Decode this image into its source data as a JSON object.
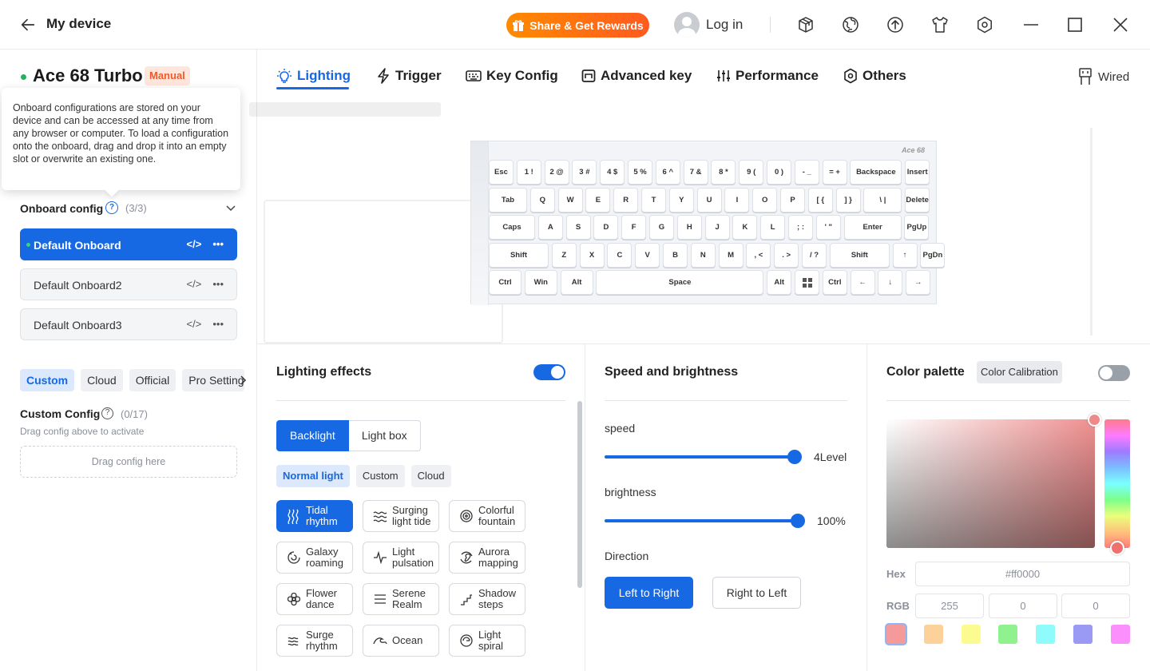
{
  "header": {
    "back_label": "My device",
    "rewards_label": "Share & Get Rewards",
    "login_label": "Log in"
  },
  "sidebar": {
    "device_name": "Ace 68 Turbo",
    "mode_badge": "Manual",
    "tooltip_text": "Onboard configurations are stored on your device and can be accessed at any time from any browser or computer. To load a configuration onto the onboard, drag and drop it into an empty slot or overwrite an existing one.",
    "onboard_label": "Onboard config",
    "onboard_count": "(3/3)",
    "slots": [
      "Default Onboard",
      "Default Onboard2",
      "Default Onboard3"
    ],
    "config_tabs": [
      "Custom",
      "Cloud",
      "Official",
      "Pro Settings"
    ],
    "custom_config_label": "Custom Config",
    "custom_config_count": "(0/17)",
    "custom_hint": "Drag config above to activate",
    "drop_label": "Drag config here"
  },
  "tabs": [
    "Lighting",
    "Trigger",
    "Key Config",
    "Advanced key",
    "Performance",
    "Others"
  ],
  "connection": "Wired",
  "keyboard": {
    "brand": "Ace 68",
    "rows": [
      [
        "Esc",
        "1 !",
        "2 @",
        "3 #",
        "4 $",
        "5 %",
        "6 ^",
        "7 &",
        "8 *",
        "9 (",
        "0 )",
        "- _",
        "= +",
        "Backspace",
        "Insert"
      ],
      [
        "Tab",
        "Q",
        "W",
        "E",
        "R",
        "T",
        "Y",
        "U",
        "I",
        "O",
        "P",
        "[ {",
        "] }",
        "\\ |",
        "Delete"
      ],
      [
        "Caps",
        "A",
        "S",
        "D",
        "F",
        "G",
        "H",
        "J",
        "K",
        "L",
        "; :",
        "' \"",
        "Enter",
        "PgUp"
      ],
      [
        "Shift",
        "Z",
        "X",
        "C",
        "V",
        "B",
        "N",
        "M",
        ", <",
        ". >",
        "/ ?",
        "Shift",
        "↑",
        "PgDn"
      ],
      [
        "Ctrl",
        "Win",
        "Alt",
        "Space",
        "Alt",
        "",
        "Ctrl",
        "←",
        "↓",
        "→"
      ]
    ]
  },
  "lighting": {
    "title": "Lighting effects",
    "enabled": true,
    "modes": [
      "Backlight",
      "Light box"
    ],
    "subtabs": [
      "Normal light",
      "Custom",
      "Cloud"
    ],
    "effects": [
      [
        "Tidal",
        "rhythm"
      ],
      [
        "Surging",
        "light tide"
      ],
      [
        "Colorful",
        "fountain"
      ],
      [
        "Galaxy",
        "roaming"
      ],
      [
        "Light",
        "pulsation"
      ],
      [
        "Aurora",
        "mapping"
      ],
      [
        "Flower",
        "dance"
      ],
      [
        "Serene",
        "Realm"
      ],
      [
        "Shadow",
        "steps"
      ],
      [
        "Surge",
        "rhythm"
      ],
      [
        "Ocean",
        ""
      ],
      [
        "Light",
        "spiral"
      ]
    ]
  },
  "speed_brightness": {
    "title": "Speed and brightness",
    "speed_label": "speed",
    "speed_value": "4Level",
    "speed_level": 1.0,
    "brightness_label": "brightness",
    "brightness_value": "100%",
    "brightness_level": 1.0,
    "direction_label": "Direction",
    "directions": [
      "Left to Right",
      "Right to Left"
    ]
  },
  "palette": {
    "title": "Color palette",
    "calibration_label": "Color Calibration",
    "calibration_on": false,
    "hex_label": "Hex",
    "hex_value": "#ff0000",
    "rgb_label": "RGB",
    "rgb": [
      "255",
      "0",
      "0"
    ],
    "swatches": [
      "#f59a9a",
      "#fdd29a",
      "#fbfb8f",
      "#8ff28f",
      "#8ffbfb",
      "#9a9af5",
      "#fb8ffb"
    ]
  }
}
